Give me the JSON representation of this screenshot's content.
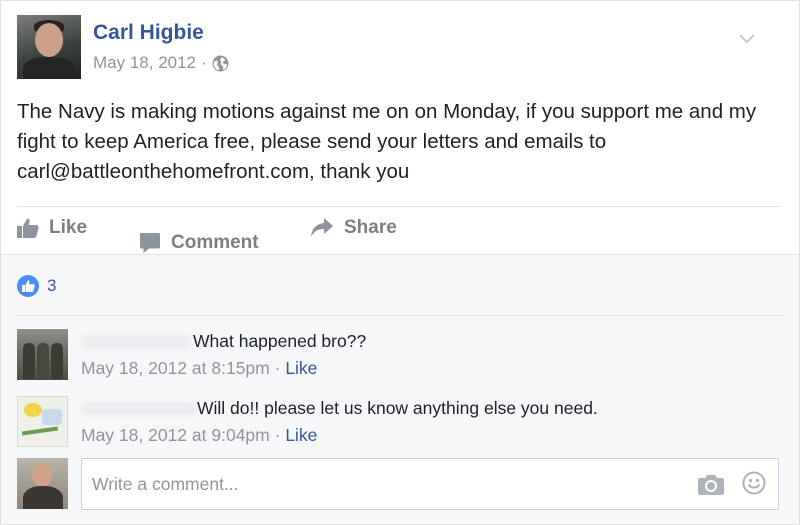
{
  "post": {
    "author": "Carl Higbie",
    "date": "May 18, 2012",
    "separator": "·",
    "audience_icon": "globe-icon",
    "text": "The Navy is making motions against me on on Monday, if you support me and my fight to keep America free, please send your letters and emails to carl@battleonthehomefront.com, thank you"
  },
  "actions": {
    "like_label": "Like",
    "comment_label": "Comment",
    "share_label": "Share"
  },
  "reactions": {
    "like_count": "3"
  },
  "comments": [
    {
      "text": "What happened bro??",
      "timestamp": "May 18, 2012 at 8:15pm",
      "separator": "·",
      "like_label": "Like"
    },
    {
      "text": "Will do!! please let us know anything else you need.",
      "timestamp": "May 18, 2012 at 9:04pm",
      "separator": "·",
      "like_label": "Like"
    }
  ],
  "composer": {
    "placeholder": "Write a comment...",
    "icons": [
      "camera-icon",
      "smiley-icon"
    ]
  },
  "colors": {
    "link_blue": "#365899",
    "meta_gray": "#90949c",
    "like_badge_blue": "#4a8ef5",
    "action_gray": "#7f7f7f"
  }
}
